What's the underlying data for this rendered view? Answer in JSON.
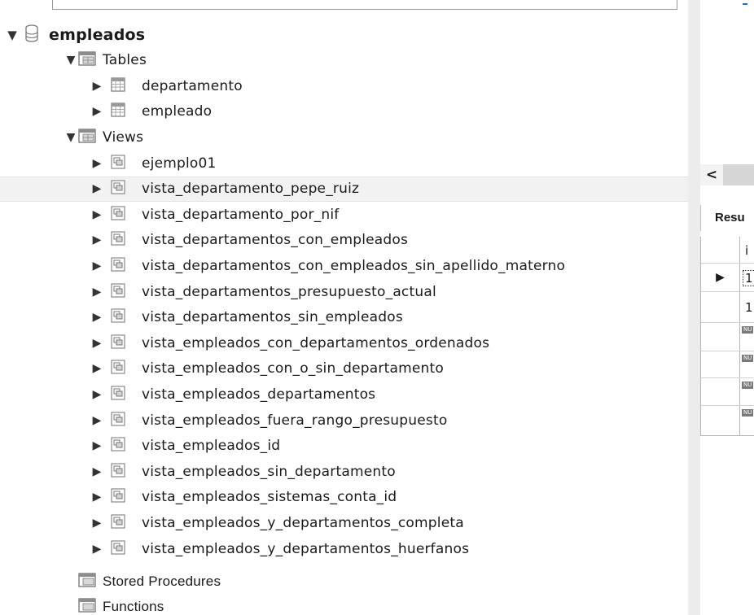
{
  "tree": {
    "database": "empleados",
    "tables_label": "Tables",
    "tables": [
      "departamento",
      "empleado"
    ],
    "views_label": "Views",
    "views": [
      "ejemplo01",
      "vista_departamento_pepe_ruiz",
      "vista_departamento_por_nif",
      "vista_departamentos_con_empleados",
      "vista_departamentos_con_empleados_sin_apellido_materno",
      "vista_departamentos_presupuesto_actual",
      "vista_departamentos_sin_empleados",
      "vista_empleados_con_departamentos_ordenados",
      "vista_empleados_con_o_sin_departamento",
      "vista_empleados_departamentos",
      "vista_empleados_fuera_rango_presupuesto",
      "vista_empleados_id",
      "vista_empleados_sin_departamento",
      "vista_empleados_sistemas_conta_id",
      "vista_empleados_y_departamentos_completa",
      "vista_empleados_y_departamentos_huerfanos"
    ],
    "selected_view": "vista_departamento_pepe_ruiz",
    "stored_procedures_label": "Stored Procedures",
    "functions_label": "Functions"
  },
  "right_pane": {
    "scroll_left_glyph": "<",
    "result_tab_label": "Resu",
    "grid_header": "i",
    "row_pointer": "▶",
    "cells": [
      "1",
      "1"
    ],
    "null_badge": "NU"
  },
  "icons": {
    "database": "database-icon",
    "folder": "folder-icon",
    "table": "table-icon",
    "view": "view-icon"
  },
  "colors": {
    "selection": "#f2f2f2",
    "null_badge": "#7a7a7a"
  }
}
